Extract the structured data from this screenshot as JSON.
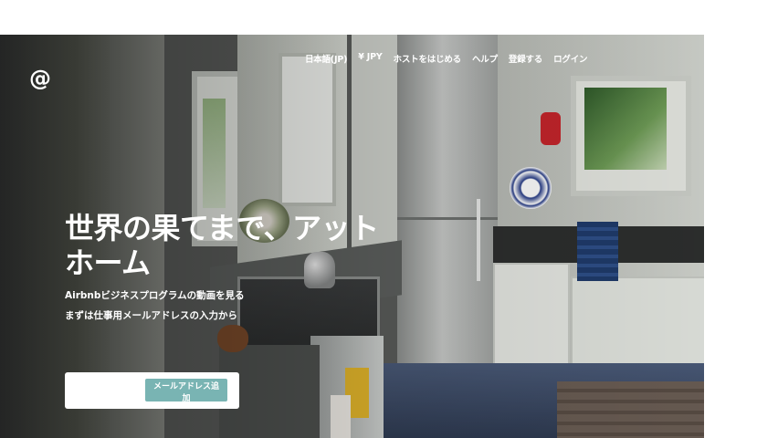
{
  "logo": {
    "text": "@",
    "icon": "at-logo-icon"
  },
  "nav": {
    "language": "日本語(JP)",
    "currency": "¥ JPY",
    "host": "ホストをはじめる",
    "help": "ヘルプ",
    "signup": "登録する",
    "login": "ログイン"
  },
  "hero": {
    "headline": "世界の果てまで、アットホーム",
    "video_link": "Airbnbビジネスプログラムの動画を見る",
    "prompt": "まずは仕事用メールアドレスの入力から"
  },
  "form": {
    "email_value": "",
    "email_placeholder": "",
    "submit_label": "メールアドレス追加"
  },
  "colors": {
    "button": "#79b4b3",
    "text": "#ffffff"
  }
}
